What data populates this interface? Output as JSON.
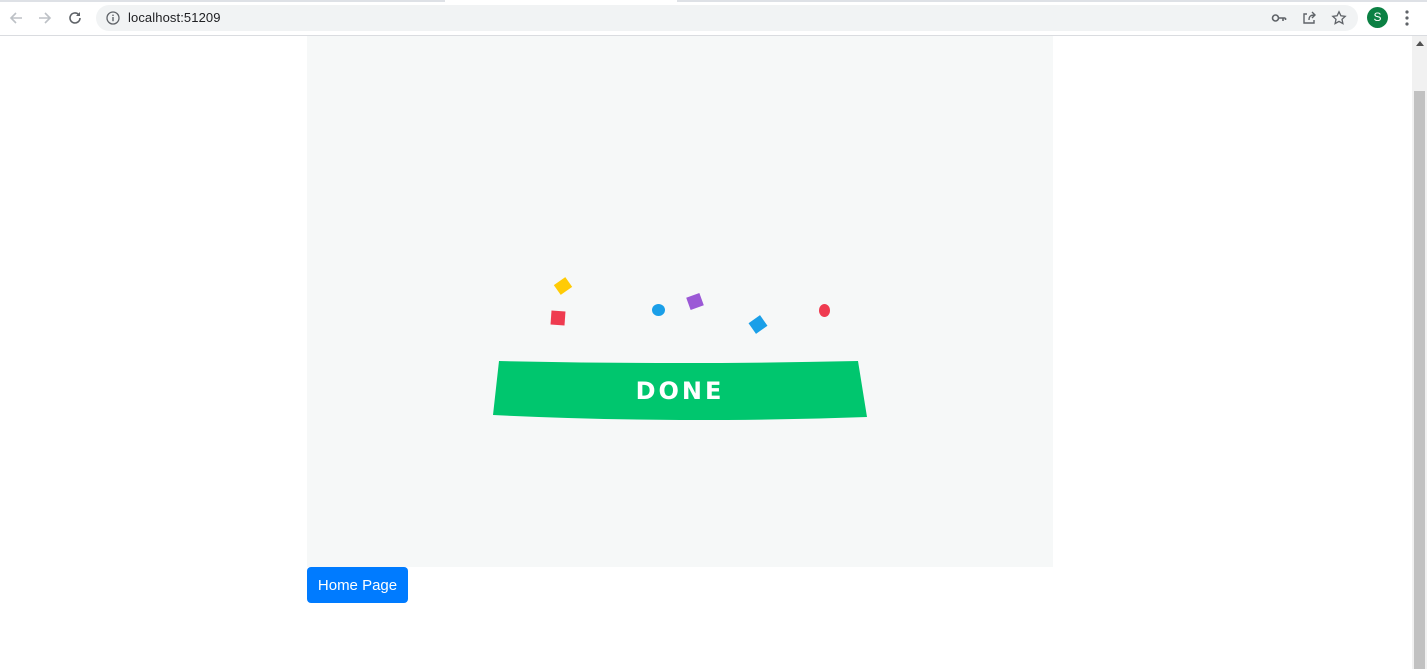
{
  "browser": {
    "url": "localhost:51209",
    "profile_initial": "S",
    "icons": [
      "back-icon",
      "forward-icon",
      "reload-icon",
      "info-icon",
      "key-icon",
      "share-icon",
      "star-icon",
      "kebab-menu-icon"
    ],
    "avatar_color": "#0b8043"
  },
  "page": {
    "banner_text": "DONE",
    "banner_color": "#00c66e",
    "confetti_colors": [
      "#ffcb05",
      "#ef3b50",
      "#1a9fe8",
      "#9b59d6",
      "#1a9fe8",
      "#ef3b50"
    ],
    "home_button_label": "Home Page",
    "home_button_color": "#007bff"
  }
}
